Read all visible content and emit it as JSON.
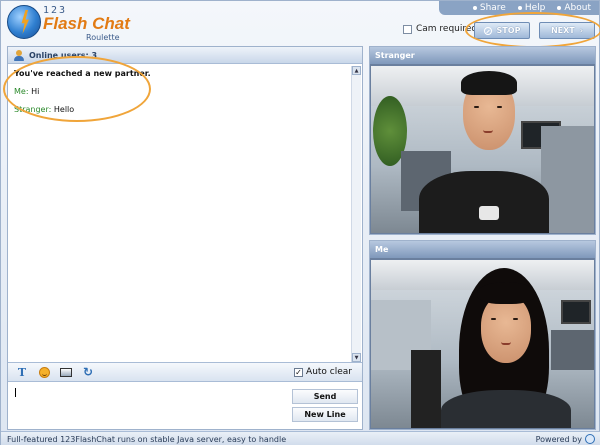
{
  "logo": {
    "number": "123",
    "name": "Flash Chat",
    "subtitle": "Roulette"
  },
  "toplinks": [
    {
      "label": "Share"
    },
    {
      "label": "Help"
    },
    {
      "label": "About"
    }
  ],
  "controls": {
    "cam_required_label": "Cam required",
    "stop_label": "STOP",
    "next_label": "NEXT",
    "next_arrow": "›"
  },
  "chat": {
    "online_users_label": "Online users: 3",
    "system_message": "You've reached a new partner.",
    "messages": [
      {
        "who": "Me:",
        "text": "Hi"
      },
      {
        "who": "Stranger:",
        "text": "Hello"
      }
    ],
    "auto_clear_label": "Auto clear",
    "auto_clear_checked": "✓",
    "send_label": "Send",
    "new_line_label": "New Line",
    "tool_text_glyph": "T",
    "tool_refresh_glyph": "↻",
    "scroll_up_glyph": "▲",
    "scroll_down_glyph": "▼"
  },
  "video": {
    "stranger_label": "Stranger",
    "me_label": "Me"
  },
  "footer": {
    "text": "Full-featured 123FlashChat runs on stable Java server, easy to handle",
    "powered_by": "Powered by"
  },
  "colors": {
    "accent_orange": "#e27b14",
    "header_blue": "#8aa3c4",
    "annotation": "#f0a53a"
  }
}
